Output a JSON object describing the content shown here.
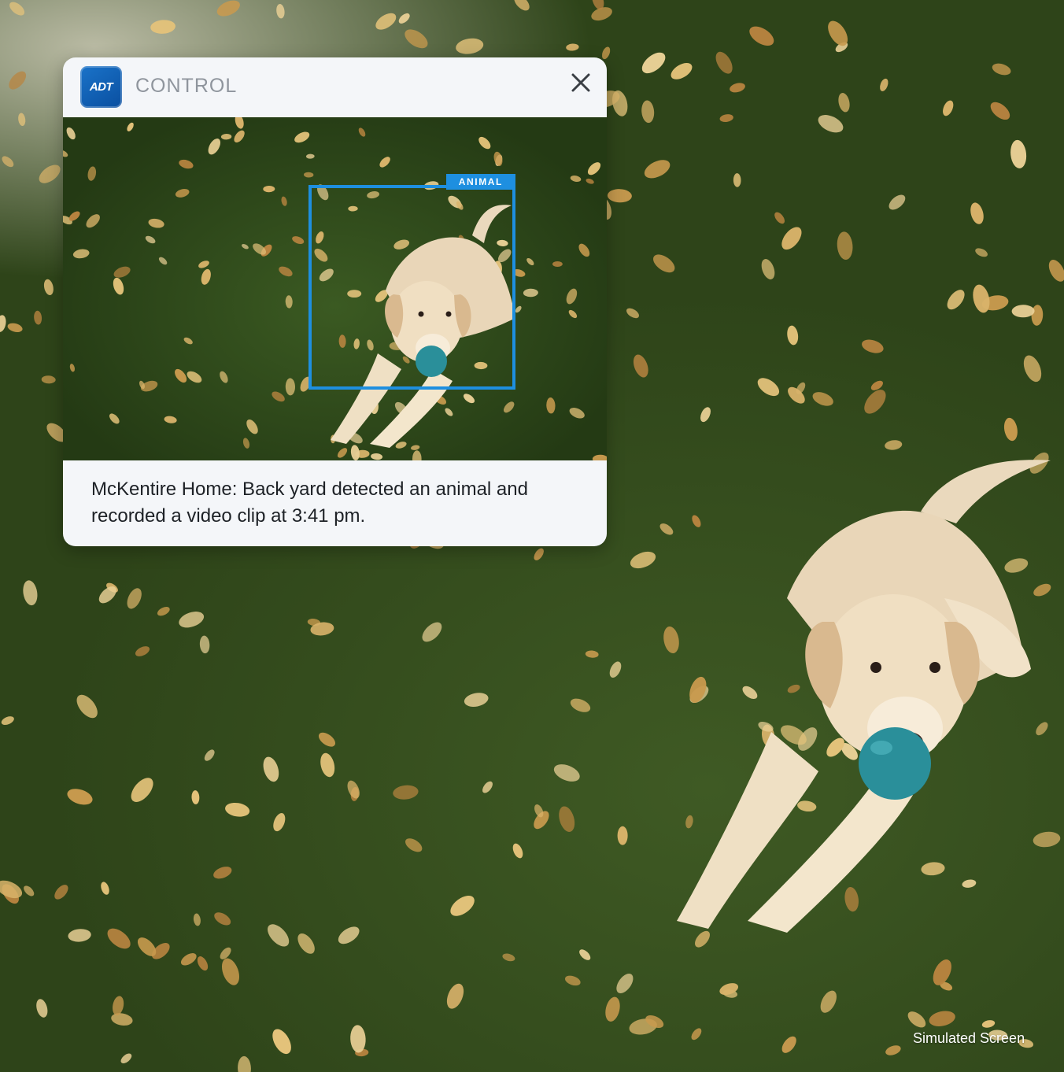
{
  "notification": {
    "app_logo_text": "ADT",
    "app_name": "CONTROL",
    "detection_label": "ANIMAL",
    "message_line1": "McKentire Home: Back yard detected an animal and",
    "message_line2": "recorded a video clip at 3:41 pm."
  },
  "footer": {
    "disclaimer": "Simulated Screen"
  },
  "colors": {
    "brand_blue": "#0a4fa0",
    "detection_blue": "#1e8fe0",
    "card_background": "#f4f6f9"
  }
}
